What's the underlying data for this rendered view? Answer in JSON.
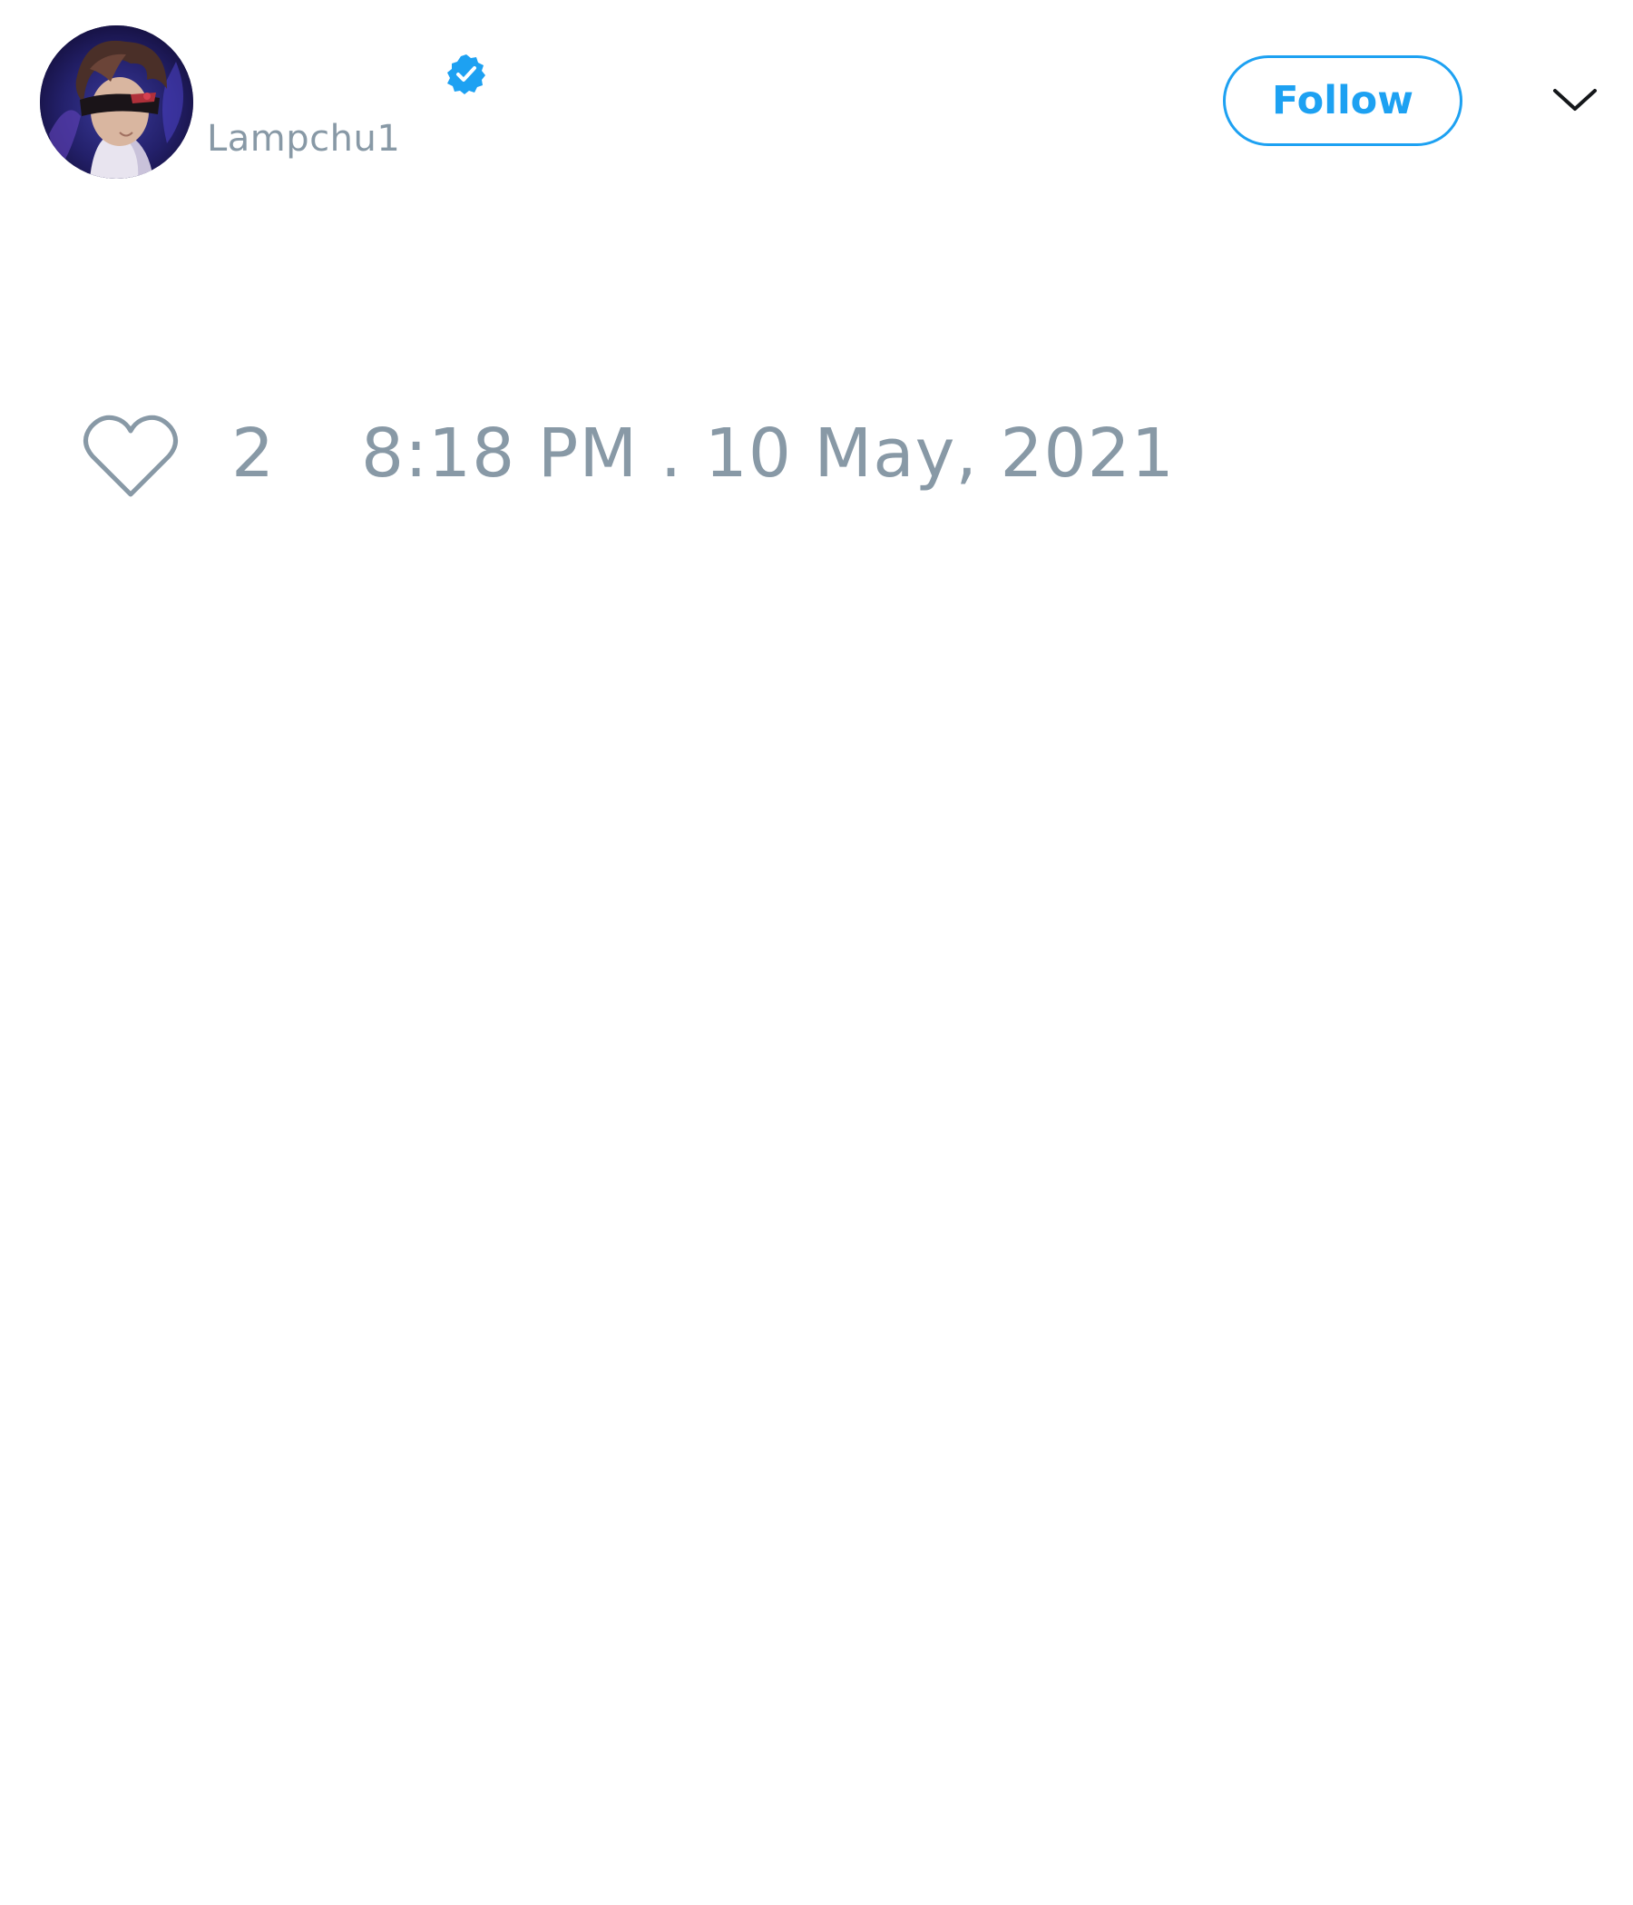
{
  "tweet": {
    "author": {
      "display_name": "",
      "handle": "Lampchu1",
      "verified": true,
      "avatar_icon": "user-avatar-image",
      "verified_icon": "verified-badge-icon"
    },
    "follow_label": "Follow",
    "menu_icon": "chevron-down-icon",
    "like_icon": "heart-outline-icon",
    "like_count": "2",
    "timestamp": "8:18 PM . 10 May, 2021"
  },
  "colors": {
    "accent": "#1da1f2",
    "muted_text": "#8899a6",
    "background": "#ffffff"
  }
}
